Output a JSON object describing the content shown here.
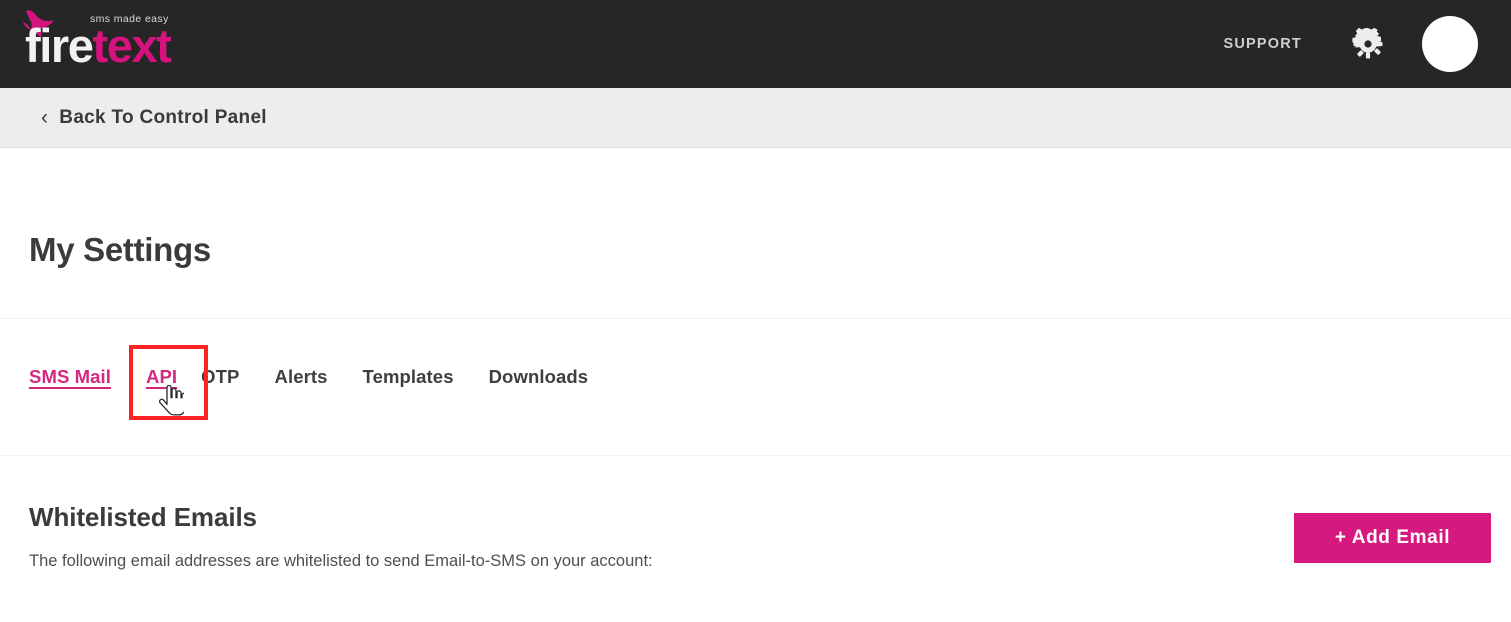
{
  "header": {
    "logo": {
      "tagline": "sms made easy",
      "name_part1": "fire",
      "name_part2": "text",
      "bird_icon": "firetext-bird-icon"
    },
    "support_label": "SUPPORT",
    "gear_icon": "gear-icon",
    "avatar_icon": "user-avatar"
  },
  "subheader": {
    "back_chevron": "‹",
    "back_label": "Back To Control Panel"
  },
  "main": {
    "page_title": "My Settings",
    "tabs": [
      {
        "label": "SMS Mail",
        "active": true
      },
      {
        "label": "API",
        "active": true
      },
      {
        "label": "OTP",
        "active": false
      },
      {
        "label": "Alerts",
        "active": false
      },
      {
        "label": "Templates",
        "active": false
      },
      {
        "label": "Downloads",
        "active": false
      }
    ],
    "section": {
      "title": "Whitelisted Emails",
      "description": "The following email addresses are whitelisted to send Email-to-SMS on your account:",
      "add_button_label": "+ Add Email"
    }
  },
  "colors": {
    "brand_pink": "#d6197f",
    "header_dark": "#262626",
    "subheader_gray": "#eceded",
    "highlight_red": "#ff2323",
    "text_dark": "#3b3b3b"
  }
}
